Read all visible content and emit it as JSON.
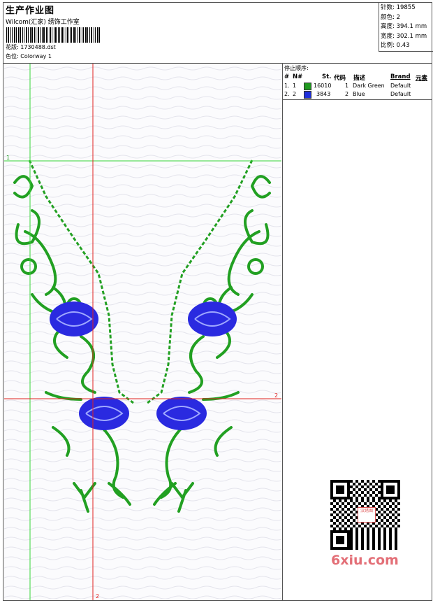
{
  "header": {
    "title": "生产作业图",
    "studio": "Wilcom(汇家) 绣饰工作室",
    "pattern_label": "花版:",
    "pattern_file": "1730488.dst",
    "colorway_label": "色位:",
    "colorway": "Colorway 1"
  },
  "stats": [
    {
      "label": "针数:",
      "value": "19855"
    },
    {
      "label": "颜色:",
      "value": "2"
    },
    {
      "label": "高度:",
      "value": "394.1 mm"
    },
    {
      "label": "宽度:",
      "value": "302.1 mm"
    },
    {
      "label": "比例:",
      "value": "0.43"
    }
  ],
  "stop_sequence": {
    "title": "停止顺序:",
    "headers": {
      "hash": "#",
      "no": "N#",
      "stitches": "St.",
      "code": "代码",
      "desc": "描述",
      "brand": "Brand",
      "element": "元素"
    },
    "rows": [
      {
        "idx": "1.",
        "no": "1",
        "stitches": "16010",
        "code": "1",
        "desc": "Dark Green",
        "brand": "Default",
        "color": "#1f9a1f"
      },
      {
        "idx": "2.",
        "no": "2",
        "stitches": "3843",
        "code": "2",
        "desc": "Blue",
        "brand": "Default",
        "color": "#1f2fdc"
      }
    ]
  },
  "guides": {
    "h1": "1",
    "v1": "1",
    "h2": "2",
    "v2": "2"
  },
  "colors": {
    "green": "#22a022",
    "blue": "#2a2ae0",
    "green_guide": "#36d436",
    "red_guide": "#e02020"
  },
  "watermark": "6xiu.com",
  "qr_center": "汉绣图"
}
